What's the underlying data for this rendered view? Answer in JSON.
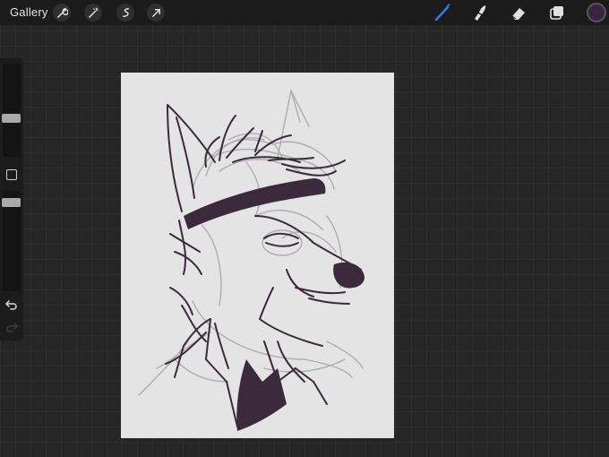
{
  "topbar": {
    "gallery_label": "Gallery",
    "left_tools": [
      "wrench-icon",
      "magic-wand-icon",
      "selection-icon",
      "transform-arrow-icon"
    ],
    "right_tools": [
      "brush-icon",
      "smudge-icon",
      "eraser-icon",
      "layers-icon"
    ],
    "active_tool": "brush-icon",
    "colors": {
      "accent": "#2f7de1",
      "current_color": "#3a2440"
    }
  },
  "sidebar": {
    "brush_size_level": 0.25,
    "opacity_level": 0.15,
    "icons": [
      "modify-square-icon",
      "undo-icon",
      "redo-icon"
    ]
  },
  "canvas": {
    "ink_color": "#3b2a3b",
    "sketch_color": "#a8a8a8",
    "paper_color": "#e4e4e4"
  }
}
